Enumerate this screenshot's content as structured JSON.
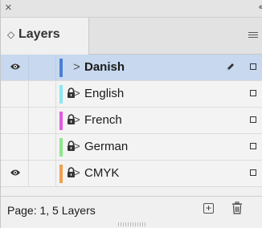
{
  "window": {
    "close_glyph": "×",
    "collapse_glyph": "‹‹"
  },
  "tab": {
    "label": "Layers",
    "sort_glyph": "◇"
  },
  "layers": [
    {
      "name": "Danish",
      "visible": true,
      "locked": false,
      "color": "#4a7fd6",
      "selected": true,
      "editing": true
    },
    {
      "name": "English",
      "visible": false,
      "locked": true,
      "color": "#8ce6f2",
      "selected": false,
      "editing": false
    },
    {
      "name": "French",
      "visible": false,
      "locked": true,
      "color": "#e35be0",
      "selected": false,
      "editing": false
    },
    {
      "name": "German",
      "visible": false,
      "locked": true,
      "color": "#8ee68a",
      "selected": false,
      "editing": false
    },
    {
      "name": "CMYK",
      "visible": true,
      "locked": true,
      "color": "#f0a050",
      "selected": false,
      "editing": false
    }
  ],
  "chevron": ">",
  "footer": {
    "status": "Page: 1, 5 Layers",
    "new_layer_glyph": "+"
  }
}
